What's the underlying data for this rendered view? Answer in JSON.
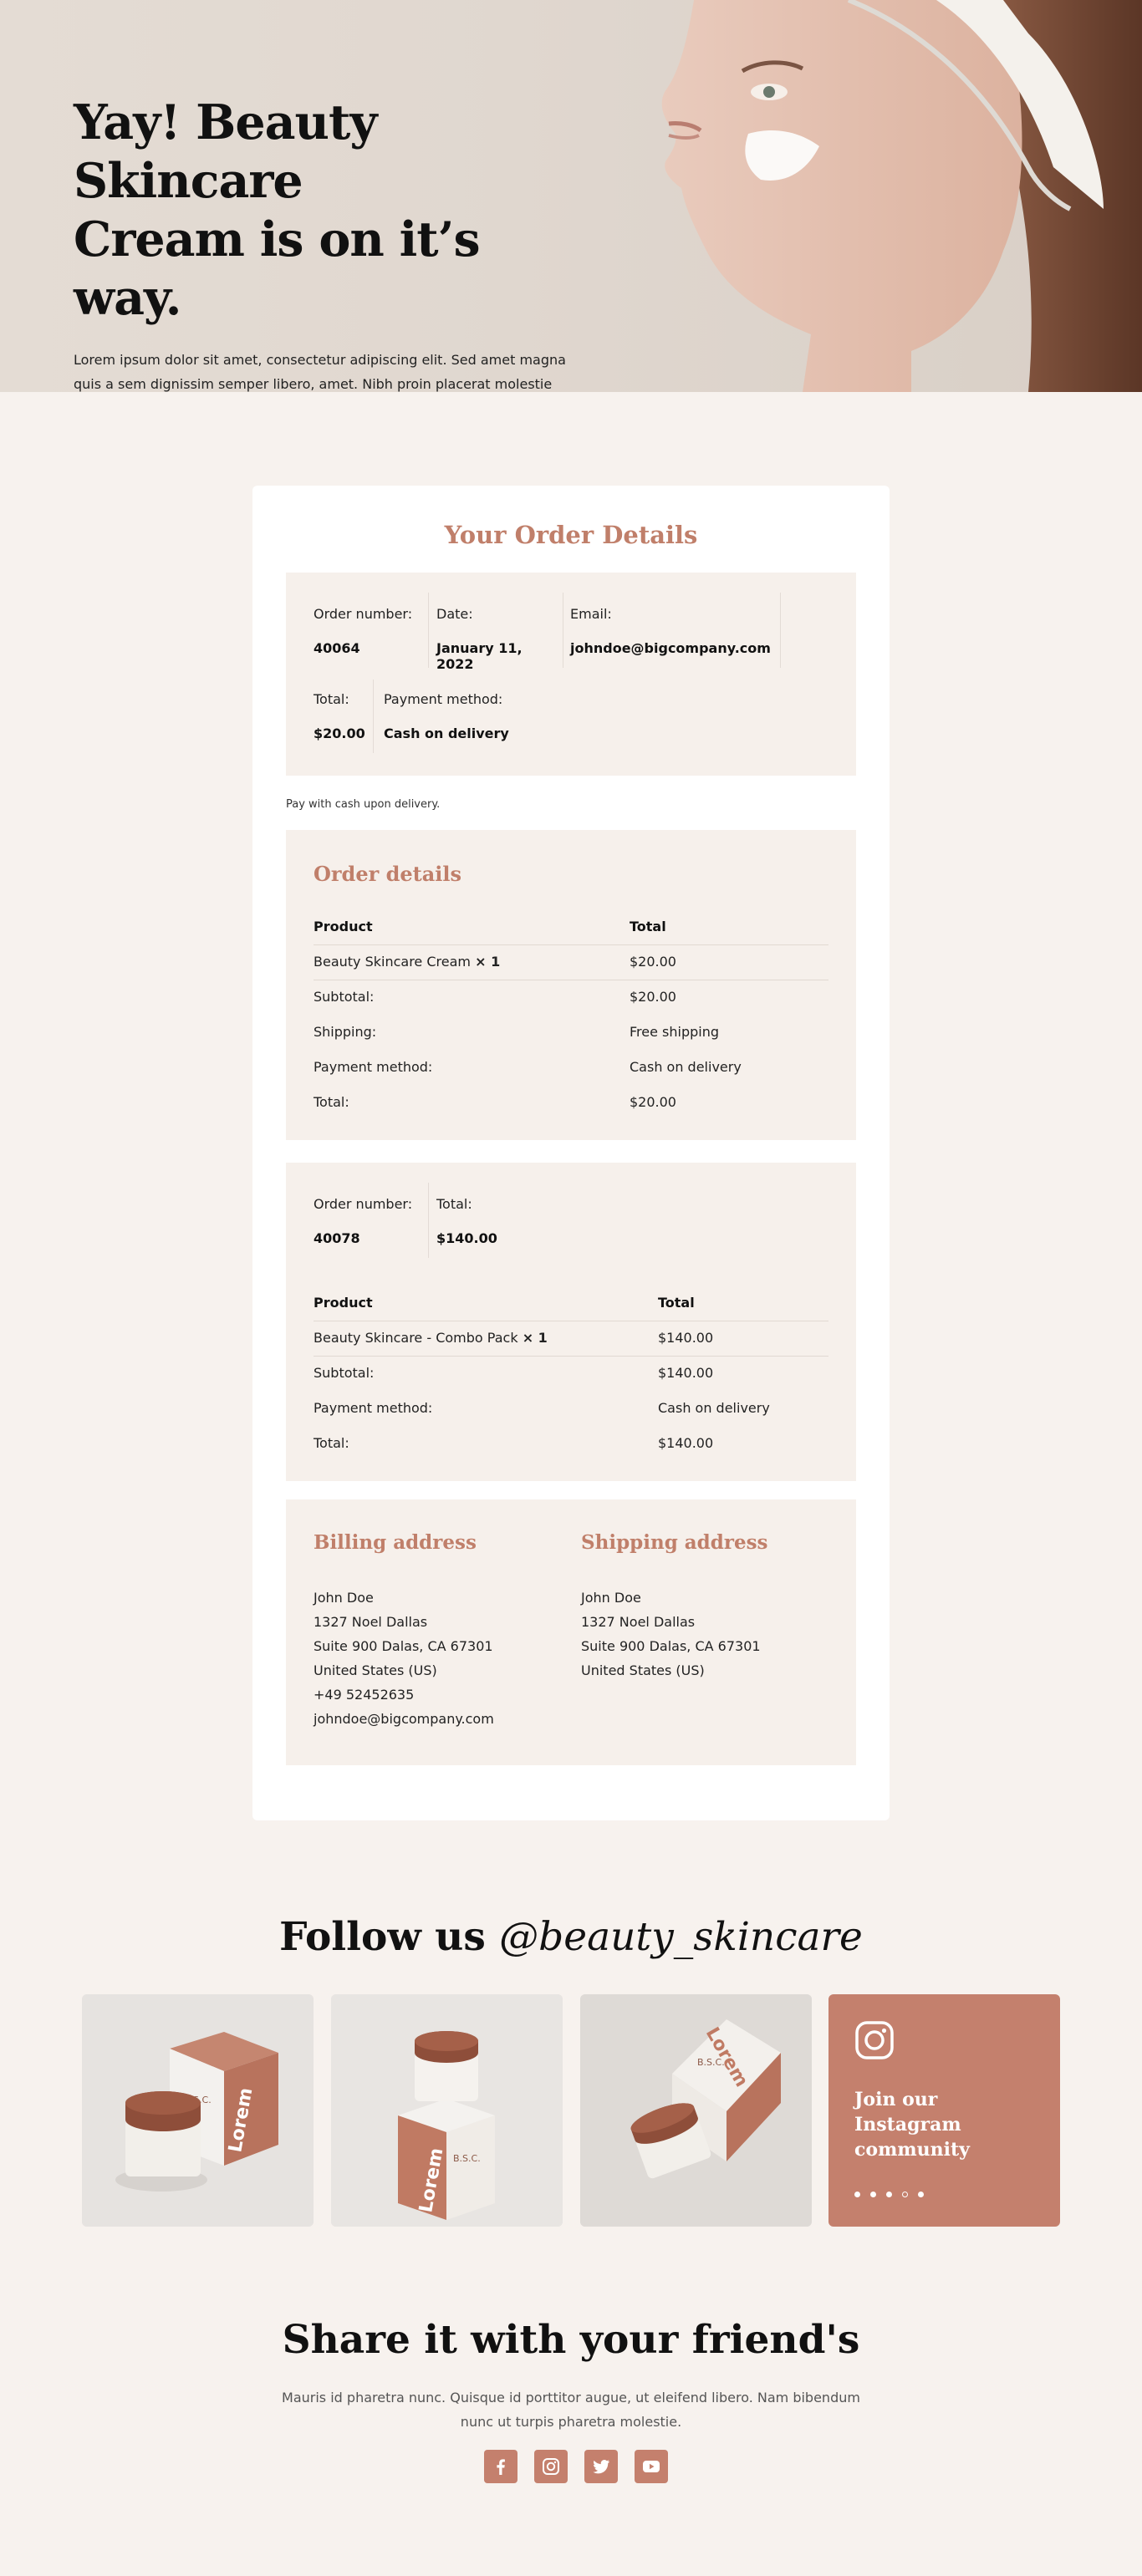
{
  "hero": {
    "title_line1": "Yay! Beauty Skincare",
    "title_line2": "Cream is on it’s way.",
    "description": "Lorem ipsum dolor sit amet, consectetur adipiscing elit. Sed amet magna quis a sem dignissim semper libero, amet. Nibh proin placerat molestie vestibulum."
  },
  "order_card": {
    "title": "Your Order Details",
    "overview": {
      "order_number_label": "Order number:",
      "order_number": "40064",
      "date_label": "Date:",
      "date": "January 11, 2022",
      "email_label": "Email:",
      "email": "johndoe@bigcompany.com",
      "total_label": "Total:",
      "total": "$20.00",
      "payment_label": "Payment method:",
      "payment": "Cash on delivery"
    },
    "payment_note": "Pay with cash upon delivery.",
    "order_details": {
      "title": "Order details",
      "header": {
        "product": "Product",
        "total": "Total"
      },
      "item": {
        "name": "Beauty Skincare Cream",
        "qty": "× 1",
        "total": "$20.00"
      },
      "rows": [
        {
          "label": "Subtotal:",
          "value": "$20.00"
        },
        {
          "label": "Shipping:",
          "value": "Free shipping"
        },
        {
          "label": "Payment method:",
          "value": "Cash on delivery"
        },
        {
          "label": "Total:",
          "value": "$20.00"
        }
      ]
    },
    "second_order": {
      "order_number_label": "Order number:",
      "order_number": "40078",
      "total_label": "Total:",
      "total": "$140.00",
      "header": {
        "product": "Product",
        "total": "Total"
      },
      "item": {
        "name": "Beauty Skincare - Combo Pack",
        "qty": "× 1",
        "total": "$140.00"
      },
      "rows": [
        {
          "label": "Subtotal:",
          "value": "$140.00"
        },
        {
          "label": "Payment method:",
          "value": "Cash on delivery"
        },
        {
          "label": "Total:",
          "value": "$140.00"
        }
      ]
    },
    "billing": {
      "title": "Billing address",
      "lines": [
        "John Doe",
        "1327 Noel Dallas",
        "Suite 900 Dalas, CA 67301",
        "United States (US)",
        "+49 52452635",
        "johndoe@bigcompany.com"
      ]
    },
    "shipping": {
      "title": "Shipping address",
      "lines": [
        "John Doe",
        "1327 Noel Dallas",
        "Suite 900 Dalas, CA 67301",
        "United States (US)"
      ]
    }
  },
  "follow": {
    "prefix": "Follow us ",
    "handle": "@beauty_skincare",
    "box_brand": "Lorem",
    "box_label": "B.S.C.",
    "instagram_text": "Join our Instagram community"
  },
  "share": {
    "title": "Share it with your friend's",
    "description": "Mauris id pharetra nunc. Quisque id porttitor augue, ut eleifend libero. Nam bibendum nunc ut turpis pharetra molestie.",
    "icons": [
      "facebook-icon",
      "instagram-icon",
      "twitter-icon",
      "youtube-icon"
    ]
  },
  "colors": {
    "accent": "#c07f6a",
    "page_bg": "#f7f2ee",
    "panel_bg": "#f6f0eb"
  }
}
